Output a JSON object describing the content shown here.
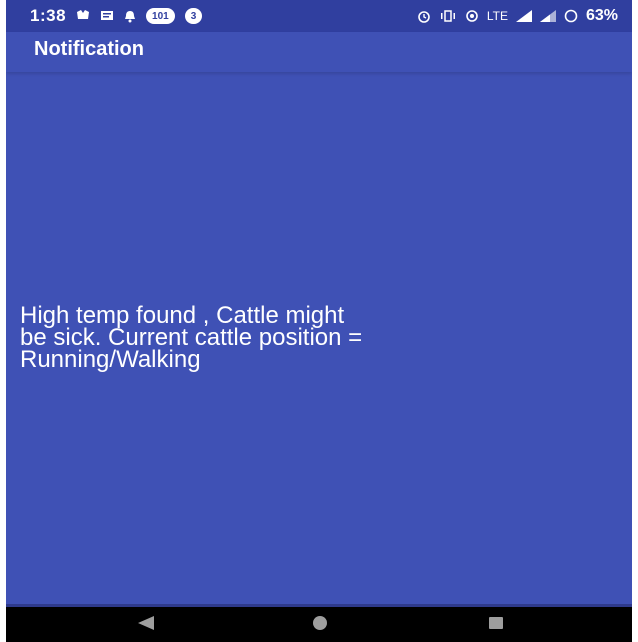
{
  "status_bar": {
    "time": "1:38",
    "badge_1": "101",
    "badge_2": "3",
    "network": "LTE",
    "battery": "63%",
    "icons": [
      "notification-icon",
      "message-icon",
      "bell-icon",
      "alarm-icon",
      "vibrate-icon",
      "hotspot-icon",
      "signal-icon",
      "signal-2-icon",
      "battery-icon"
    ]
  },
  "app_bar": {
    "title": "Notification"
  },
  "content": {
    "message": "High temp found , Cattle might\nbe sick. Current cattle position =\nRunning/Walking"
  },
  "nav_bar": {
    "icons": [
      "back-icon",
      "home-icon",
      "recents-icon"
    ]
  },
  "colors": {
    "primary": "#3f51b5",
    "primary_dark": "#303f9f",
    "nav_bar": "#000000",
    "text": "#ffffff"
  }
}
